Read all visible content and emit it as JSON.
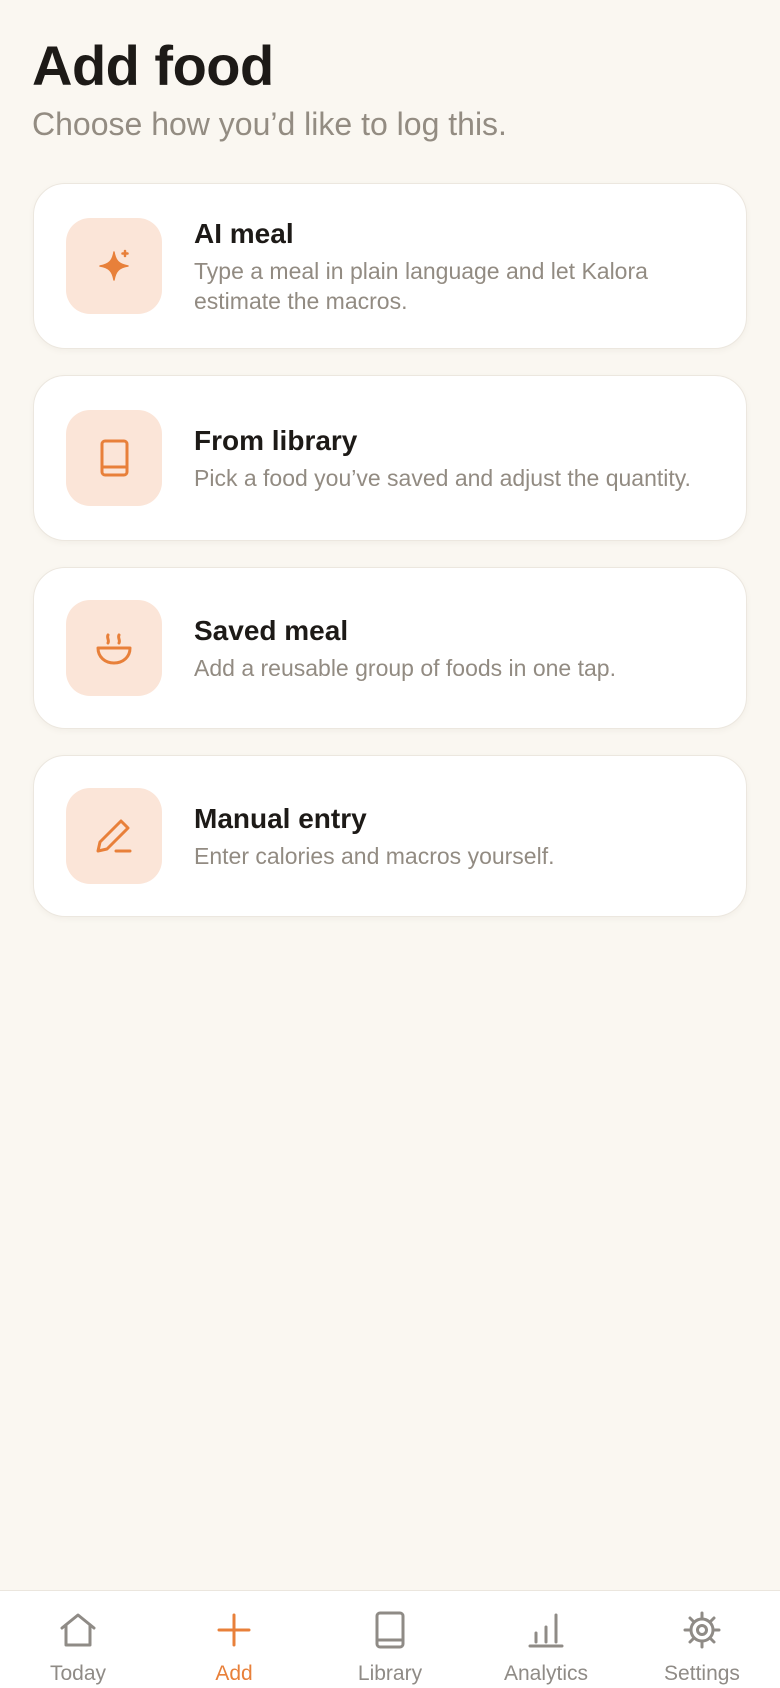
{
  "header": {
    "title": "Add food",
    "subtitle": "Choose how you’d like to log this."
  },
  "options": [
    {
      "title": "AI meal",
      "description": "Type a meal in plain language and let Kalora estimate the macros.",
      "icon": "sparkle-icon"
    },
    {
      "title": "From library",
      "description": "Pick a food you’ve saved and adjust the quantity.",
      "icon": "book-icon"
    },
    {
      "title": "Saved meal",
      "description": "Add a reusable group of foods in one tap.",
      "icon": "bowl-icon"
    },
    {
      "title": "Manual entry",
      "description": "Enter calories and macros yourself.",
      "icon": "pencil-icon"
    }
  ],
  "tabs": [
    {
      "label": "Today",
      "icon": "home-icon",
      "active": false
    },
    {
      "label": "Add",
      "icon": "plus-icon",
      "active": true
    },
    {
      "label": "Library",
      "icon": "book-icon",
      "active": false
    },
    {
      "label": "Analytics",
      "icon": "bar-chart-icon",
      "active": false
    },
    {
      "label": "Settings",
      "icon": "gear-icon",
      "active": false
    }
  ],
  "colors": {
    "accent": "#e8803a",
    "accent_soft": "#fbe5d8",
    "background": "#faf7f1",
    "muted_text": "#928b82"
  }
}
